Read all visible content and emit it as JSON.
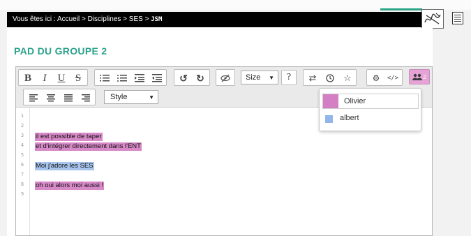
{
  "breadcrumb": {
    "prefix": "Vous êtes ici : ",
    "accueil": "Accueil",
    "sep": " > ",
    "disciplines": "Disciplines",
    "ses": "SES",
    "current": "JSM"
  },
  "page_title": "PAD DU GROUPE 2",
  "toolbar": {
    "bold": "B",
    "italic": "I",
    "underline": "U",
    "strike": "S",
    "size_label": "Size",
    "help": "?",
    "style_label": "Style",
    "users_count": "2"
  },
  "colors": {
    "accent": "#2ba28b",
    "olivier": "#d47fc4",
    "albert": "#91b6ea"
  },
  "editor": {
    "line_numbers": [
      "1",
      "2",
      "3",
      "4",
      "5",
      "6",
      "7",
      "8",
      "9"
    ],
    "lines": [
      {
        "text": "il est possible de taper",
        "author": "olivier"
      },
      {
        "text": "et d'intégrer directement dans l'ENT",
        "author": "olivier"
      },
      {
        "text": "Moi j'adore les SES",
        "author": "albert"
      },
      {
        "text": "oh oui alors moi aussi !",
        "author": "olivier"
      }
    ]
  },
  "users_popup": {
    "users": [
      {
        "name": "Olivier"
      },
      {
        "name": "albert"
      }
    ]
  },
  "icons": [
    "signature-icon",
    "menu-icon",
    "ordered-list-icon",
    "unordered-list-icon",
    "indent-icon",
    "outdent-icon",
    "undo-icon",
    "redo-icon",
    "clear-authorship-icon",
    "import-export-icon",
    "timeslider-icon",
    "star-icon",
    "settings-icon",
    "embed-icon",
    "users-icon",
    "align-left-icon",
    "align-center-icon",
    "align-justify-icon",
    "align-right-icon"
  ]
}
